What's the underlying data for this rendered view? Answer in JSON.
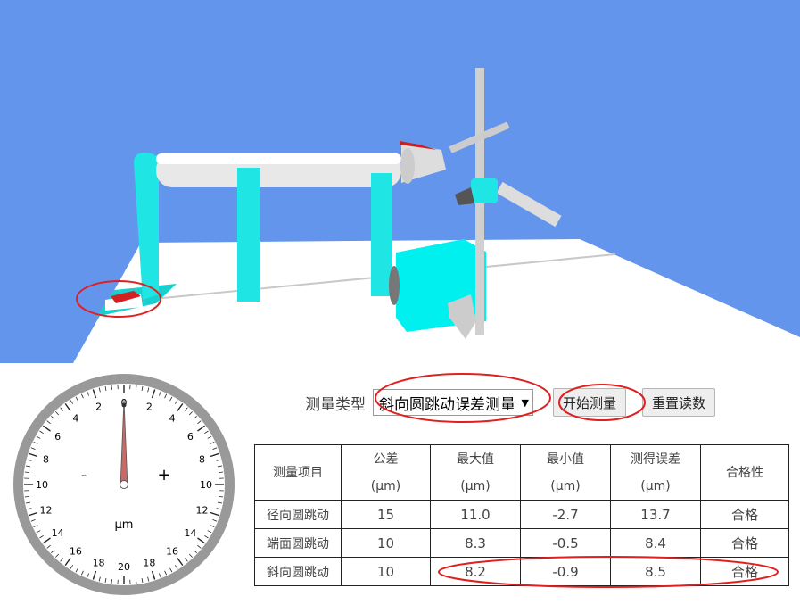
{
  "controls": {
    "measure_type_label": "测量类型",
    "measure_type_value": "斜向圆跳动误差测量",
    "start_button": "开始测量",
    "reset_button": "重置读数"
  },
  "dial": {
    "left_numbers": [
      "2",
      "4",
      "6",
      "8",
      "10",
      "12",
      "14",
      "16",
      "18"
    ],
    "right_numbers": [
      "2",
      "4",
      "6",
      "8",
      "10",
      "12",
      "14",
      "16",
      "18"
    ],
    "bottom_number": "20",
    "top_number": "0",
    "minus": "-",
    "plus": "+",
    "unit": "μm",
    "needle_reading": 0
  },
  "table": {
    "headers": [
      {
        "line1": "测量项目",
        "line2": ""
      },
      {
        "line1": "公差",
        "line2": "(μm)"
      },
      {
        "line1": "最大值",
        "line2": "(μm)"
      },
      {
        "line1": "最小值",
        "line2": "(μm)"
      },
      {
        "line1": "测得误差",
        "line2": "(μm)"
      },
      {
        "line1": "合格性",
        "line2": ""
      }
    ],
    "rows": [
      [
        "径向圆跳动",
        "15",
        "11.0",
        "-2.7",
        "13.7",
        "合格"
      ],
      [
        "端面圆跳动",
        "10",
        "8.3",
        "-0.5",
        "8.4",
        "合格"
      ],
      [
        "斜向圆跳动",
        "10",
        "8.2",
        "-0.9",
        "8.5",
        "合格"
      ]
    ]
  },
  "colors": {
    "sky": "#6495ed",
    "fixture": "#00ffff",
    "highlight": "#e02020"
  }
}
